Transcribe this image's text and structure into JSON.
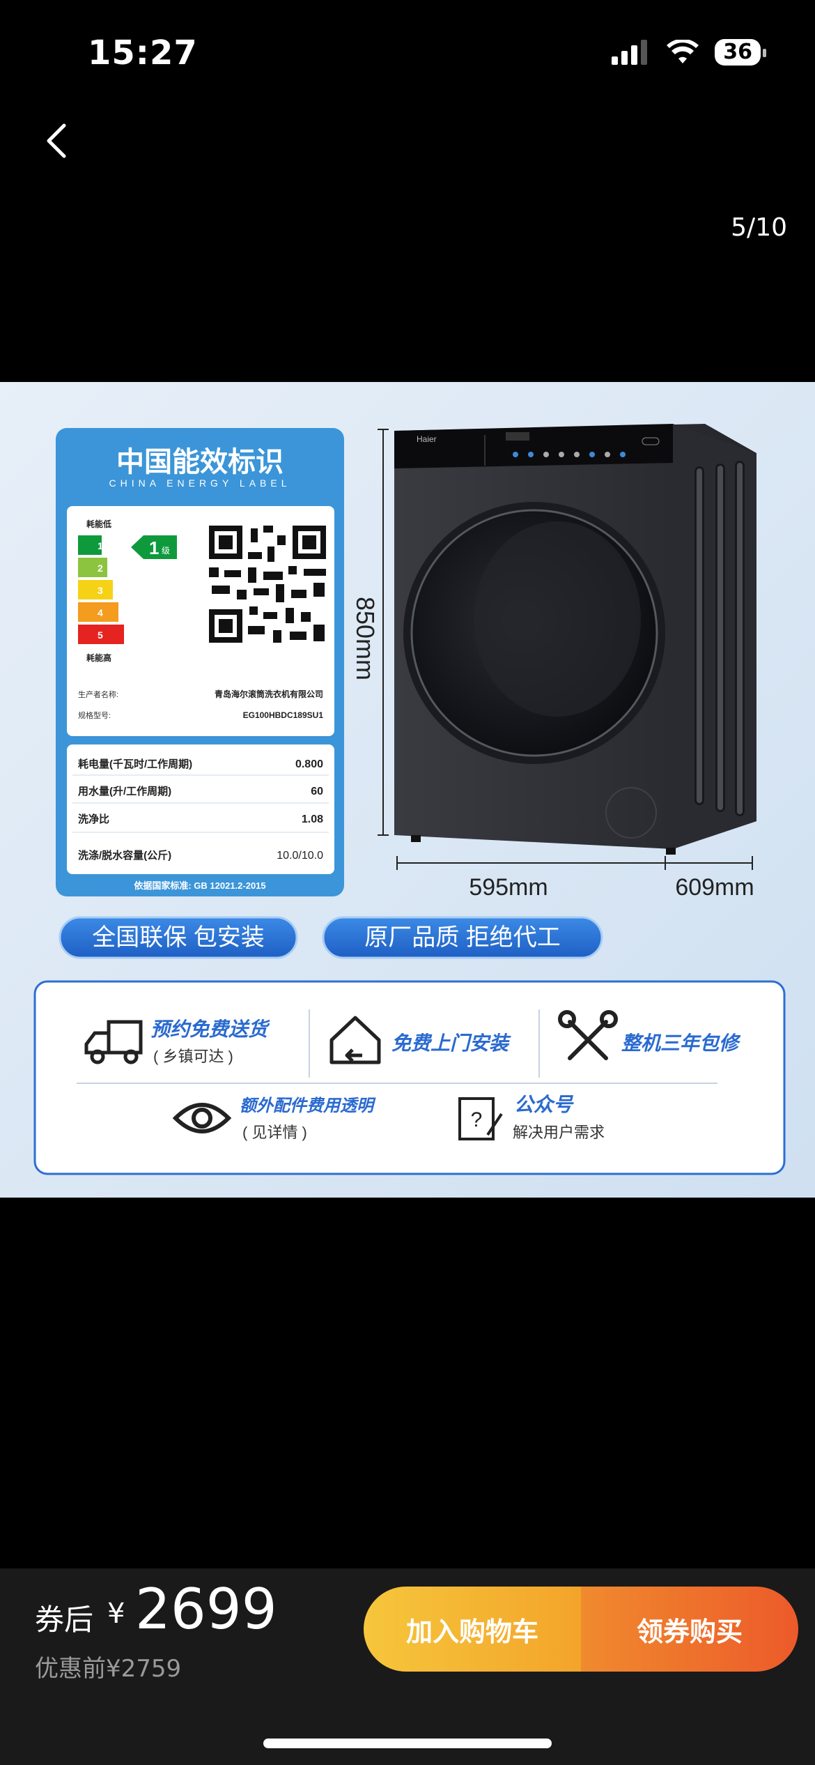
{
  "status_bar": {
    "time": "15:27",
    "battery": "36"
  },
  "viewer": {
    "counter": "5/10"
  },
  "image": {
    "energy_label": {
      "title": "中国能效标识",
      "subtitle": "CHINA  ENERGY  LABEL",
      "low": "耗能低",
      "high": "耗能高",
      "grade": "1",
      "grade_suffix": "级",
      "bars": [
        "1",
        "2",
        "3",
        "4",
        "5"
      ],
      "maker_label": "生产者名称:",
      "maker": "青岛海尔滚筒洗衣机有限公司",
      "model_label": "规格型号:",
      "model": "EG100HBDC189SU1",
      "rows": [
        {
          "label": "耗电量(千瓦时/工作周期)",
          "value": "0.800"
        },
        {
          "label": "用水量(升/工作周期)",
          "value": "60"
        },
        {
          "label": "洗净比",
          "value": "1.08"
        },
        {
          "label": "洗涤/脱水容量(公斤)",
          "value": "10.0/10.0"
        }
      ],
      "standard": "依据国家标准: GB 12021.2-2015"
    },
    "brand_on_machine": "Haier",
    "dims": {
      "height": "850mm",
      "width": "595mm",
      "depth": "609mm"
    },
    "pills": [
      "全国联保 包安装",
      "原厂品质 拒绝代工"
    ],
    "services": [
      {
        "icon": "truck-icon",
        "title": "预约免费送货",
        "sub": "( 乡镇可达 )"
      },
      {
        "icon": "house-icon",
        "title": "免费上门安装",
        "sub": ""
      },
      {
        "icon": "tools-icon",
        "title": "整机三年包修",
        "sub": ""
      },
      {
        "icon": "eye-icon",
        "title": "额外配件费用透明",
        "sub": "( 见详情 )"
      },
      {
        "icon": "question-icon",
        "title": "公众号",
        "sub": "解决用户需求"
      }
    ]
  },
  "bottom_bar": {
    "after_coupon_label": "券后",
    "currency": "¥",
    "price": "2699",
    "original": "优惠前¥2759",
    "add_cart": "加入购物车",
    "buy": "领券购买"
  }
}
